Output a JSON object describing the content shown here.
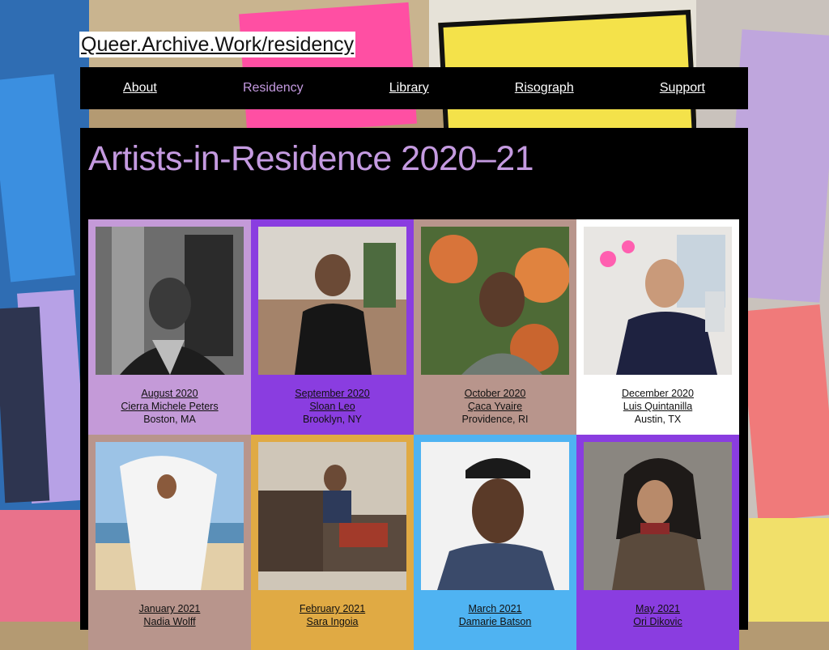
{
  "site": {
    "title_link": "Queer.Archive.Work",
    "title_rest": "/residency"
  },
  "nav": {
    "items": [
      "About",
      "Residency",
      "Library",
      "Risograph",
      "Support"
    ],
    "current": "Residency"
  },
  "page": {
    "heading": "Artists-in-Residence 2020–21"
  },
  "residents": [
    {
      "month": "August 2020",
      "name": "Cierra Michele Peters",
      "place": "Boston, MA",
      "bg": "#c49ad8"
    },
    {
      "month": "September 2020",
      "name": "Sloan Leo",
      "place": "Brooklyn, NY",
      "bg": "#8a3de0"
    },
    {
      "month": "October 2020",
      "name": "Çaca Yvaire",
      "place": "Providence, RI",
      "bg": "#b8958c"
    },
    {
      "month": "December 2020",
      "name": "Luis Quintanilla",
      "place": "Austin, TX",
      "bg": "#ffffff"
    },
    {
      "month": "January 2021",
      "name": "Nadia Wolff",
      "place": "",
      "bg": "#b8958c"
    },
    {
      "month": "February 2021",
      "name": "Sara Ingoia",
      "place": "",
      "bg": "#e0aa44"
    },
    {
      "month": "March 2021",
      "name": "Damarie Batson",
      "place": "",
      "bg": "#4fb3f2"
    },
    {
      "month": "May 2021",
      "name": "Ori Dikovic",
      "place": "",
      "bg": "#8a3de0"
    }
  ],
  "colors": {
    "accent": "#c49ae0",
    "nav_bg": "#000000",
    "panel_bg": "#000000"
  }
}
